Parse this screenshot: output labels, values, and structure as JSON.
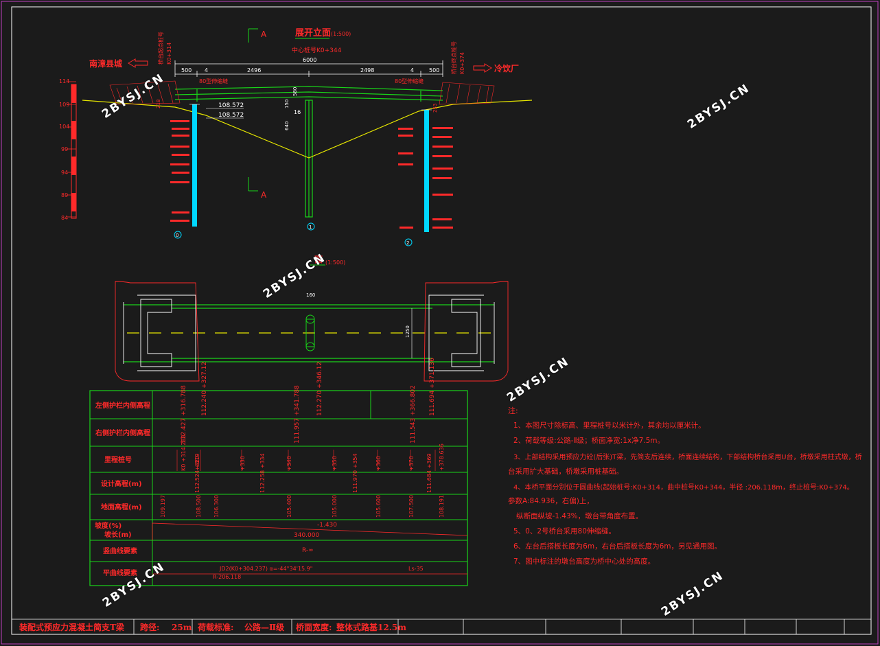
{
  "drawing": {
    "elevation_title": "展开立面",
    "elevation_scale": "(1:500)",
    "plan_title": "面",
    "plan_scale": "(1:500)",
    "section_mark": "A",
    "center_station": "中心桩号K0+344",
    "left_station_label": "桥台起点桩号",
    "left_station": "K0+314",
    "right_station_label": "桥台终点桩号",
    "right_station": "K0+374",
    "left_direction": "南漳县城",
    "right_direction": "冷饮厂",
    "dims": {
      "total": "6000",
      "d500": "500",
      "d4": "4",
      "d2496": "2496",
      "d2498": "2498",
      "width": "1250",
      "pier_w": "160",
      "pier_h": "580",
      "d16": "16",
      "d218": "218",
      "d150": "150",
      "d253": "253",
      "d640": "640"
    },
    "expansion_joint": "80型伸缩缝",
    "elev_marks": [
      "108.572",
      "108.572"
    ],
    "scale_ticks": [
      "114",
      "109",
      "104",
      "99",
      "94",
      "89",
      "84"
    ],
    "pier_labels": [
      "0",
      "1",
      "2"
    ]
  },
  "profile_table": {
    "rows": [
      "左侧护栏内侧高程",
      "右侧护栏内侧高程",
      "里程桩号",
      "设计高程(m)",
      "地面高程(m)",
      "坡度(%)",
      "坡长(m)",
      "竖曲线要素",
      "平曲线要素"
    ],
    "left_rail": [
      "112.240 +327.12",
      "112.270 +346.12",
      "111.694 +371.136"
    ],
    "right_rail": [
      "112.427 +316.788",
      "111.957 +341.788",
      "111.543 +366.802"
    ],
    "stations": [
      "K0 +314.288",
      "+320",
      "+330",
      "+340",
      "+350",
      "+360",
      "+370",
      "+378.636"
    ],
    "design_elev": [
      "112.524 +319",
      "112.258 +334",
      "111.970 +354",
      "111.684 +369"
    ],
    "ground_elev": [
      "109.197",
      "108.500",
      "106.300",
      "105.400",
      "105.000",
      "105.600",
      "107.500",
      "108.191"
    ],
    "grade": "-1.430",
    "length": "340.000",
    "vertical": "R-∞",
    "horizontal": "JD2(K0+304.237)  α=-44°34'15.9\"",
    "horizontal_r": "R-206.118",
    "horizontal_ls": "Ls-35"
  },
  "notes": {
    "title": "注:",
    "items": [
      "1、本图尺寸除标高、里程桩号以米计外，其余均以厘米计。",
      "2、荷载等级:公路-Ⅱ级；桥面净宽:1x净7.5m。",
      "3、上部结构采用预应力砼(后张)T梁，先简支后连续，桥面连续结构，下部结构桥台采用U台，桥墩采用柱式墩，桥",
      "台采用扩大基础，桥墩采用桩基础。",
      "4、本桥平面分别位于圆曲线(起始桩号:K0+314，曲中桩号K0+344，半径 :206.118m，终止桩号:K0+374。",
      "参数A:84.936，右偏)上，",
      "纵断面纵坡-1.43%，墩台带角度布置。",
      "5、0、2号桥台采用80伸缩缝。",
      "6、左台后搭板长度为6m，右台后搭板长度为6m，另见通用图。",
      "7、图中标注的墩台高度为桥中心处的高度。"
    ]
  },
  "watermark": "2BYSJ.CN",
  "title_block": {
    "name": "装配式预应力混凝土简支T梁",
    "span_label": "跨径:",
    "span_value": "25m",
    "load_label": "荷载标准:",
    "load_value": "公路—Ⅱ级",
    "width_label": "桥面宽度:",
    "width_value": "整体式路基12.5m"
  },
  "colors": {
    "background": "#1b1b1b",
    "red": "#ff2a2a",
    "green": "#19d419",
    "yellow": "#e6e600",
    "cyan": "#00d8ff",
    "white": "#ffffff",
    "magenta": "#c040c0"
  }
}
